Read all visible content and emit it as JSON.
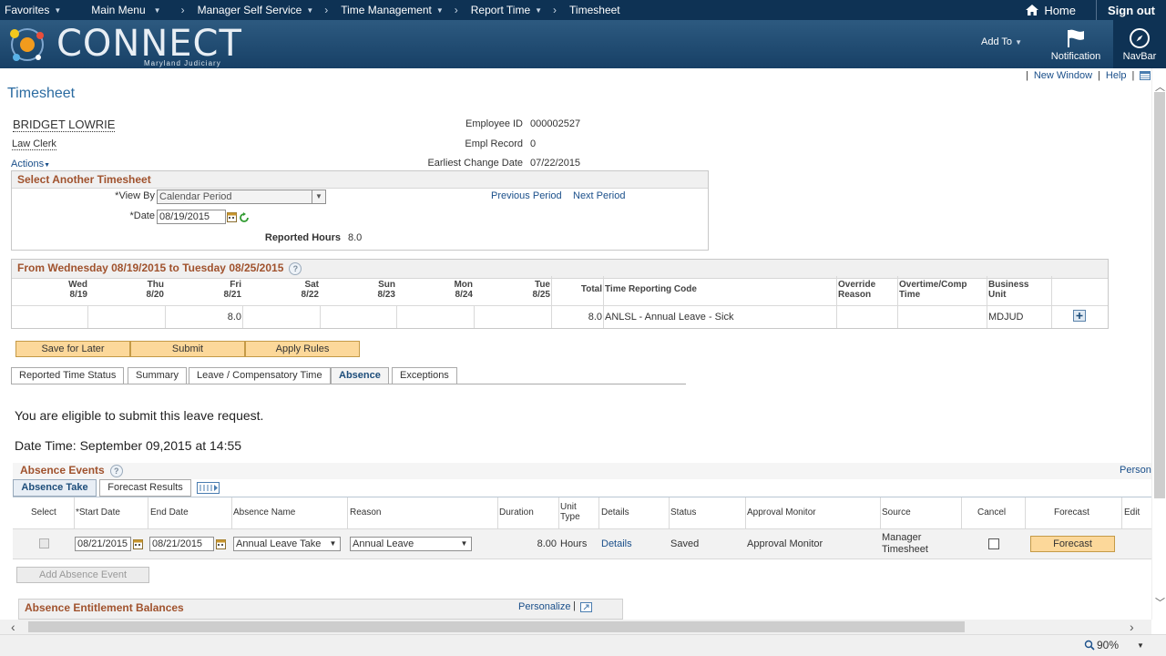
{
  "topnav": {
    "favorites": "Favorites",
    "main_menu": "Main Menu",
    "manager_self_service": "Manager Self Service",
    "time_management": "Time Management",
    "report_time": "Report Time",
    "timesheet": "Timesheet",
    "home": "Home",
    "sign_out": "Sign out"
  },
  "banner": {
    "logo_text": "CONNECT",
    "logo_sub": "Maryland Judiciary",
    "add_to": "Add To",
    "notification": "Notification",
    "navbar": "NavBar"
  },
  "page": {
    "title": "Timesheet",
    "new_window": "New Window",
    "help": "Help"
  },
  "employee": {
    "name": "BRIDGET LOWRIE",
    "title": "Law Clerk",
    "actions": "Actions",
    "employee_id_label": "Employee ID",
    "employee_id": "000002527",
    "empl_record_label": "Empl Record",
    "empl_record": "0",
    "earliest_change_label": "Earliest Change Date",
    "earliest_change": "07/22/2015"
  },
  "select_timesheet": {
    "header": "Select Another Timesheet",
    "view_by_label": "*View By",
    "view_by_value": "Calendar Period",
    "date_label": "*Date",
    "date_value": "08/19/2015",
    "previous_period": "Previous Period",
    "next_period": "Next Period",
    "reported_hours_label": "Reported Hours",
    "reported_hours": "8.0"
  },
  "period": {
    "header": "From Wednesday 08/19/2015 to Tuesday 08/25/2015",
    "days": [
      {
        "day": "Wed",
        "date": "8/19",
        "value": ""
      },
      {
        "day": "Thu",
        "date": "8/20",
        "value": ""
      },
      {
        "day": "Fri",
        "date": "8/21",
        "value": "8.0"
      },
      {
        "day": "Sat",
        "date": "8/22",
        "value": ""
      },
      {
        "day": "Sun",
        "date": "8/23",
        "value": ""
      },
      {
        "day": "Mon",
        "date": "8/24",
        "value": ""
      },
      {
        "day": "Tue",
        "date": "8/25",
        "value": ""
      }
    ],
    "total_label": "Total",
    "trc_label": "Time Reporting Code",
    "override_label_1": "Override",
    "override_label_2": "Reason",
    "overtime_label_1": "Overtime/Comp",
    "overtime_label_2": "Time",
    "bu_label_1": "Business",
    "bu_label_2": "Unit",
    "row": {
      "total": "8.0",
      "trc": "ANLSL - Annual Leave - Sick",
      "business_unit": "MDJUD"
    }
  },
  "buttons": {
    "save_for_later": "Save for Later",
    "submit": "Submit",
    "apply_rules": "Apply Rules"
  },
  "tabs": [
    {
      "label": "Reported Time Status"
    },
    {
      "label": "Summary"
    },
    {
      "label": "Leave / Compensatory Time"
    },
    {
      "label": "Absence"
    },
    {
      "label": "Exceptions"
    }
  ],
  "messages": {
    "eligible": "You are eligible to submit this leave request.",
    "datetime": "Date Time: September 09,2015 at 14:55"
  },
  "absence_events": {
    "header": "Absence Events",
    "personalize": "Person",
    "tab_absence_take": "Absence Take",
    "tab_forecast_results": "Forecast Results",
    "columns": {
      "select": "Select",
      "start_date": "*Start Date",
      "end_date": "End Date",
      "absence_name": "Absence Name",
      "reason": "Reason",
      "duration": "Duration",
      "unit_type_1": "Unit",
      "unit_type_2": "Type",
      "details": "Details",
      "status": "Status",
      "approval_monitor": "Approval Monitor",
      "source": "Source",
      "cancel": "Cancel",
      "forecast": "Forecast",
      "edit": "Edit"
    },
    "row": {
      "start_date": "08/21/2015",
      "end_date": "08/21/2015",
      "absence_name": "Annual Leave Take",
      "reason": "Annual Leave",
      "duration": "8.00",
      "unit_type": "Hours",
      "details": "Details",
      "status": "Saved",
      "approval_monitor": "Approval Monitor",
      "source_1": "Manager",
      "source_2": "Timesheet",
      "forecast_button": "Forecast"
    },
    "add_button": "Add Absence Event"
  },
  "entitlement": {
    "header": "Absence Entitlement Balances",
    "personalize": "Personalize"
  },
  "status": {
    "zoom": "90%"
  }
}
